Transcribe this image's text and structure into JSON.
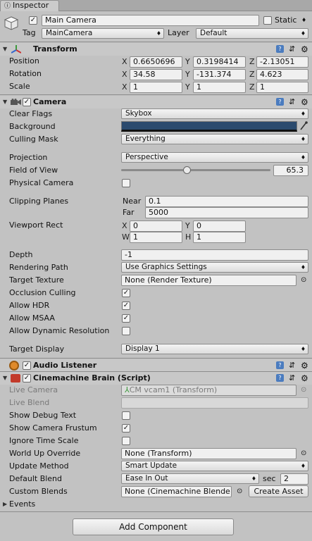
{
  "tab": {
    "title": "Inspector"
  },
  "gameobject": {
    "name": "Main Camera",
    "static_label": "Static",
    "tag_label": "Tag",
    "tag_value": "MainCamera",
    "layer_label": "Layer",
    "layer_value": "Default"
  },
  "transform": {
    "title": "Transform",
    "rows": [
      {
        "label": "Position",
        "x": "0.6650696",
        "y": "0.3198414",
        "z": "-2.13051"
      },
      {
        "label": "Rotation",
        "x": "34.58",
        "y": "-131.374",
        "z": "4.623"
      },
      {
        "label": "Scale",
        "x": "1",
        "y": "1",
        "z": "1"
      }
    ],
    "axis_x": "X",
    "axis_y": "Y",
    "axis_z": "Z"
  },
  "camera": {
    "title": "Camera",
    "clear_flags_label": "Clear Flags",
    "clear_flags_value": "Skybox",
    "background_label": "Background",
    "background_color": "#2b4a6e",
    "culling_mask_label": "Culling Mask",
    "culling_mask_value": "Everything",
    "projection_label": "Projection",
    "projection_value": "Perspective",
    "fov_label": "Field of View",
    "fov_value": "65.3",
    "fov_fraction": 0.44,
    "physical_label": "Physical Camera",
    "clipping_label": "Clipping Planes",
    "near_label": "Near",
    "near_value": "0.1",
    "far_label": "Far",
    "far_value": "5000",
    "viewport_label": "Viewport Rect",
    "vp_x": "0",
    "vp_y": "0",
    "vp_w": "1",
    "vp_h": "1",
    "vp_x_label": "X",
    "vp_y_label": "Y",
    "vp_w_label": "W",
    "vp_h_label": "H",
    "depth_label": "Depth",
    "depth_value": "-1",
    "rendering_path_label": "Rendering Path",
    "rendering_path_value": "Use Graphics Settings",
    "target_texture_label": "Target Texture",
    "target_texture_value": "None (Render Texture)",
    "occlusion_label": "Occlusion Culling",
    "hdr_label": "Allow HDR",
    "msaa_label": "Allow MSAA",
    "dynres_label": "Allow Dynamic Resolution",
    "target_display_label": "Target Display",
    "target_display_value": "Display 1"
  },
  "audio": {
    "title": "Audio Listener"
  },
  "brain": {
    "title": "Cinemachine Brain (Script)",
    "live_camera_label": "Live Camera",
    "live_camera_value": "CM vcam1 (Transform)",
    "live_blend_label": "Live Blend",
    "debug_text_label": "Show Debug Text",
    "frustum_label": "Show Camera Frustum",
    "ignore_time_label": "Ignore Time Scale",
    "world_up_label": "World Up Override",
    "world_up_value": "None (Transform)",
    "update_method_label": "Update Method",
    "update_method_value": "Smart Update",
    "default_blend_label": "Default Blend",
    "default_blend_value": "Ease In Out",
    "sec_label": "sec",
    "sec_value": "2",
    "custom_blends_label": "Custom Blends",
    "custom_blends_value": "None (Cinemachine Blende",
    "create_asset_label": "Create Asset",
    "events_label": "Events"
  },
  "footer": {
    "add_component_label": "Add Component"
  },
  "glyphs": {
    "check": "✓",
    "arrow": "♦",
    "fold_open": "▼",
    "fold_closed": "▶",
    "gear": "⚙",
    "preset": "⇵",
    "picker": "⊙",
    "help": "?"
  }
}
